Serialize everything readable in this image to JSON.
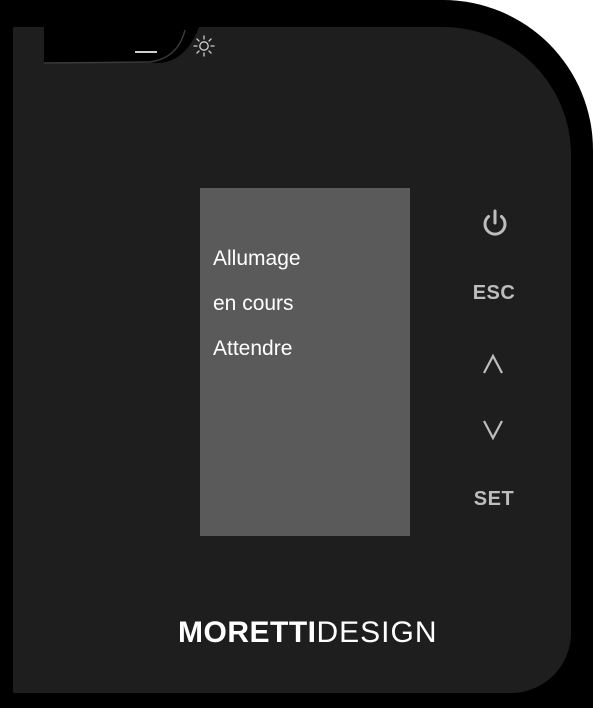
{
  "display": {
    "lines": [
      "Allumage",
      "en cours",
      "Attendre"
    ]
  },
  "controls": {
    "power_icon": "power-icon",
    "esc_label": "ESC",
    "up_icon": "chevron-up-icon",
    "down_icon": "chevron-down-icon",
    "set_label": "SET"
  },
  "indicator": {
    "icon": "sun-icon"
  },
  "brand": {
    "part1": "MORETTI",
    "part2": "DESIGN"
  },
  "colors": {
    "bezel": "#000000",
    "face": "#1e1e1e",
    "screen": "#5a5a5a",
    "screen_text": "#ffffff",
    "button_gray": "#bdbdbd"
  }
}
